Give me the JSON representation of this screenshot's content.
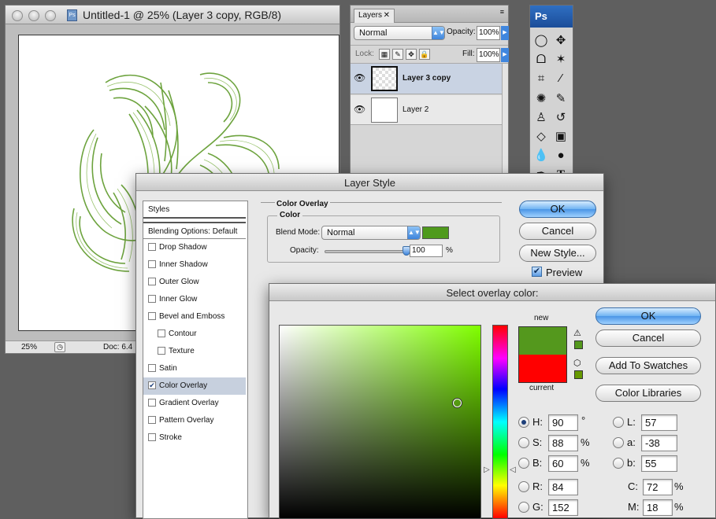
{
  "document_window": {
    "title": "Untitled-1 @ 25% (Layer 3 copy, RGB/8)",
    "zoom": "25%",
    "doc_info": "Doc: 6.4"
  },
  "layers_panel": {
    "tab": "Layers",
    "blend_mode": "Normal",
    "opacity_label": "Opacity:",
    "opacity": "100%",
    "lock_label": "Lock:",
    "fill_label": "Fill:",
    "fill": "100%",
    "layers": [
      {
        "name": "Layer 3 copy",
        "selected": true
      },
      {
        "name": "Layer 2",
        "selected": false
      }
    ]
  },
  "toolbox": {
    "logo": "Ps",
    "tools": [
      "marquee-tool-icon",
      "move-tool-icon",
      "lasso-tool-icon",
      "magic-wand-icon",
      "crop-tool-icon",
      "eyedropper-icon",
      "healing-brush-icon",
      "brush-tool-icon",
      "clone-stamp-icon",
      "history-brush-icon",
      "eraser-icon",
      "gradient-tool-icon",
      "blur-tool-icon",
      "dodge-tool-icon",
      "pen-tool-icon",
      "type-tool-icon"
    ]
  },
  "layer_style": {
    "title": "Layer Style",
    "styles_header": "Styles",
    "blending_options": "Blending Options: Default",
    "items": [
      {
        "label": "Drop Shadow",
        "checked": false,
        "indent": false
      },
      {
        "label": "Inner Shadow",
        "checked": false,
        "indent": false
      },
      {
        "label": "Outer Glow",
        "checked": false,
        "indent": false
      },
      {
        "label": "Inner Glow",
        "checked": false,
        "indent": false
      },
      {
        "label": "Bevel and Emboss",
        "checked": false,
        "indent": false
      },
      {
        "label": "Contour",
        "checked": false,
        "indent": true
      },
      {
        "label": "Texture",
        "checked": false,
        "indent": true
      },
      {
        "label": "Satin",
        "checked": false,
        "indent": false
      },
      {
        "label": "Color Overlay",
        "checked": true,
        "indent": false
      },
      {
        "label": "Gradient Overlay",
        "checked": false,
        "indent": false
      },
      {
        "label": "Pattern Overlay",
        "checked": false,
        "indent": false
      },
      {
        "label": "Stroke",
        "checked": false,
        "indent": false
      }
    ],
    "section_title": "Color Overlay",
    "group_title": "Color",
    "blend_mode_label": "Blend Mode:",
    "blend_mode": "Normal",
    "overlay_color": "#4f9a1c",
    "opacity_label": "Opacity:",
    "opacity": "100",
    "opacity_unit": "%",
    "opacity_level": 1.0,
    "ok": "OK",
    "cancel": "Cancel",
    "new_style": "New Style...",
    "preview": "Preview",
    "preview_checked": true
  },
  "color_picker": {
    "title": "Select overlay color:",
    "new_label": "new",
    "current_label": "current",
    "new_color": "#54981d",
    "current_color": "#ff0000",
    "ok": "OK",
    "cancel": "Cancel",
    "add_to_swatches": "Add To Swatches",
    "color_libraries": "Color Libraries",
    "hue_degrees": 90,
    "fields": {
      "H": {
        "label": "H:",
        "value": "90",
        "unit": "°",
        "selected": true
      },
      "S": {
        "label": "S:",
        "value": "88",
        "unit": "%"
      },
      "B": {
        "label": "B:",
        "value": "60",
        "unit": "%"
      },
      "R": {
        "label": "R:",
        "value": "84"
      },
      "G": {
        "label": "G:",
        "value": "152"
      },
      "L": {
        "label": "L:",
        "value": "57"
      },
      "a": {
        "label": "a:",
        "value": "-38"
      },
      "b": {
        "label": "b:",
        "value": "55"
      },
      "C": {
        "label": "C:",
        "value": "72",
        "unit": "%"
      },
      "M": {
        "label": "M:",
        "value": "18",
        "unit": "%"
      }
    }
  }
}
